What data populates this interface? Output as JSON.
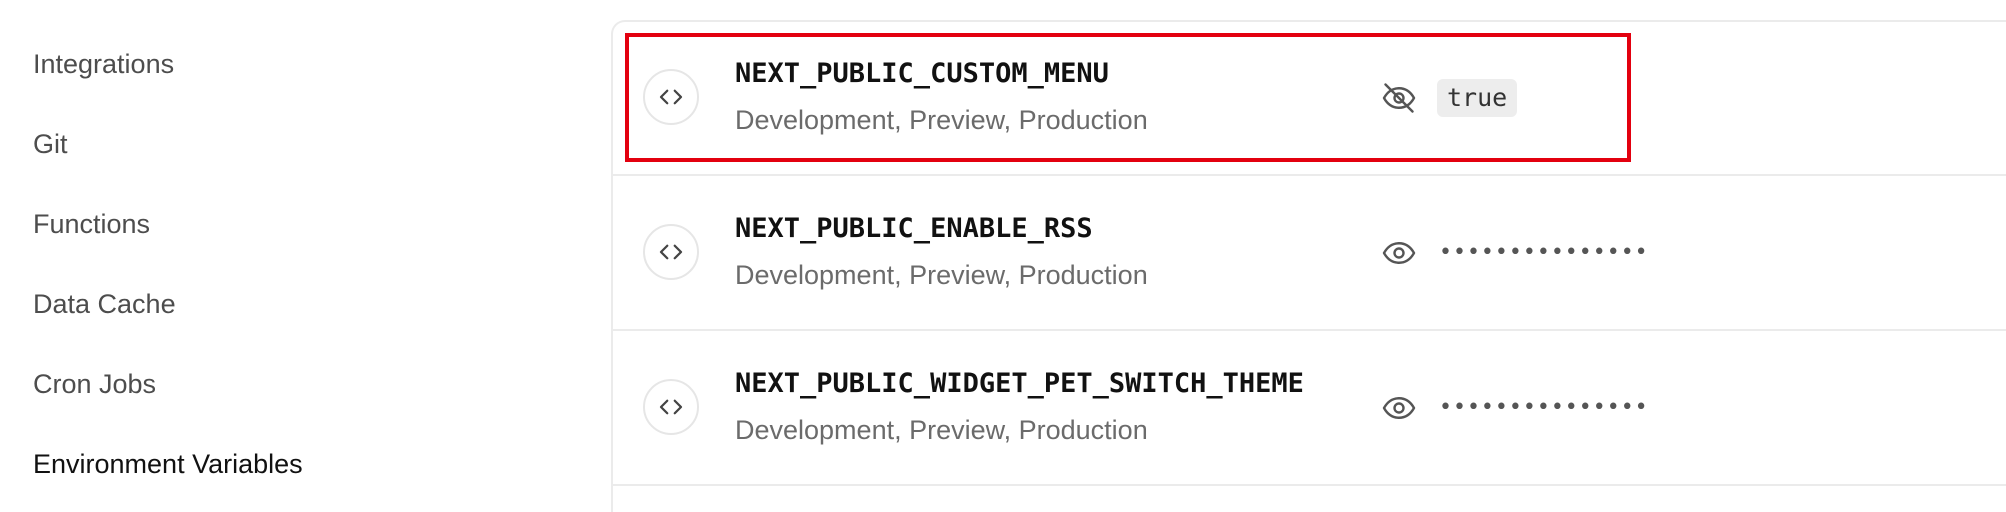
{
  "sidebar": {
    "items": [
      {
        "label": "Integrations"
      },
      {
        "label": "Git"
      },
      {
        "label": "Functions"
      },
      {
        "label": "Data Cache"
      },
      {
        "label": "Cron Jobs"
      },
      {
        "label": "Environment Variables",
        "active": true
      }
    ]
  },
  "env_vars": [
    {
      "name": "NEXT_PUBLIC_CUSTOM_MENU",
      "environments": "Development, Preview, Production",
      "value": "true",
      "revealed": true,
      "visibility_icon": "eye-off-icon"
    },
    {
      "name": "NEXT_PUBLIC_ENABLE_RSS",
      "environments": "Development, Preview, Production",
      "value": "•••••••••••••••",
      "revealed": false,
      "visibility_icon": "eye-icon"
    },
    {
      "name": "NEXT_PUBLIC_WIDGET_PET_SWITCH_THEME",
      "environments": "Development, Preview, Production",
      "value": "•••••••••••••••",
      "revealed": false,
      "visibility_icon": "eye-icon"
    }
  ],
  "colors": {
    "highlight": "#e3000f",
    "text_primary": "#111111",
    "text_secondary": "#6b6b6b",
    "border": "#ebebeb"
  }
}
